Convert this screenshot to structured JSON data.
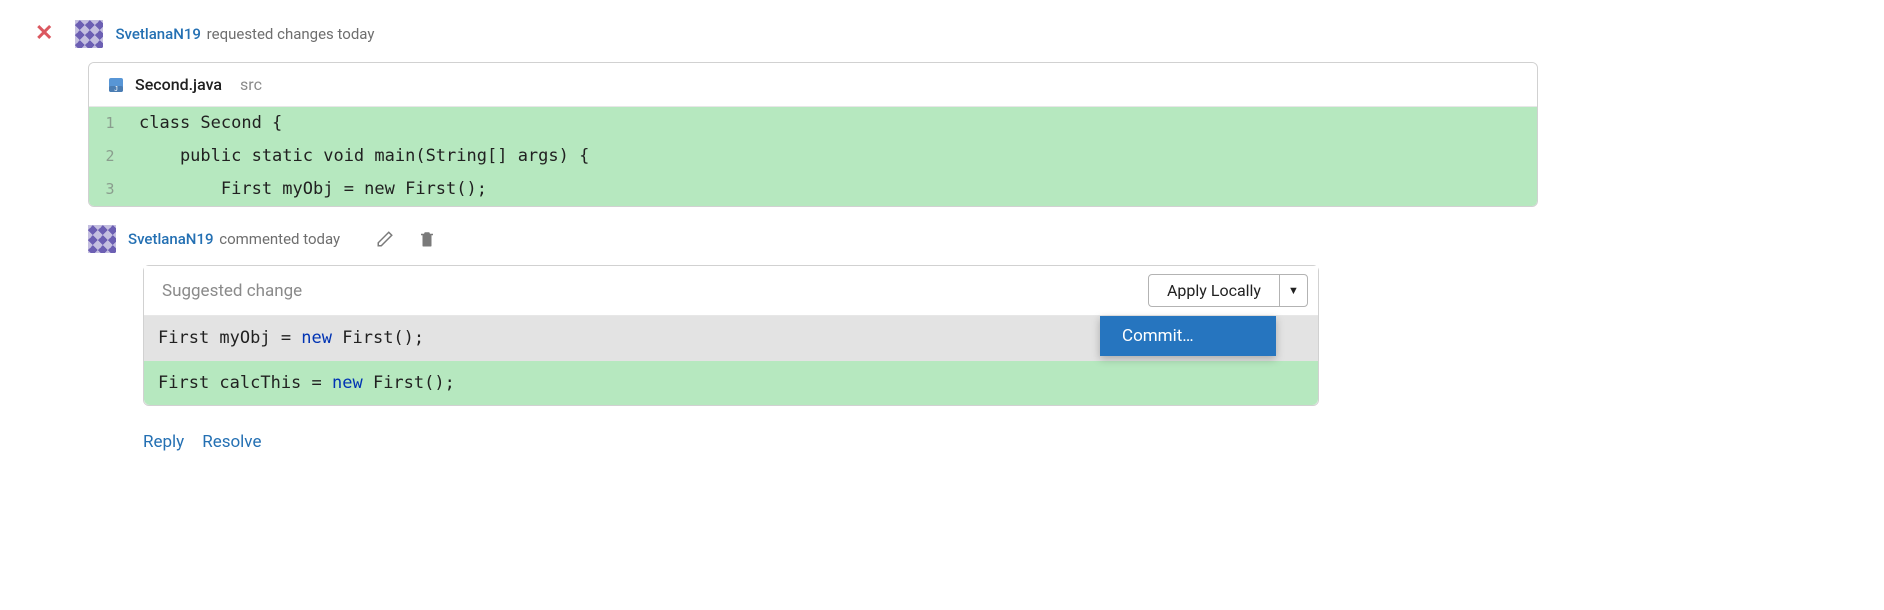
{
  "review": {
    "username": "SvetlanaN19",
    "action_text": "requested changes today"
  },
  "file": {
    "name": "Second.java",
    "dir": "src"
  },
  "code": {
    "lines": [
      {
        "num": "1",
        "text": "class Second {"
      },
      {
        "num": "2",
        "text": "    public static void main(String[] args) {"
      },
      {
        "num": "3",
        "text": "        First myObj = new First();"
      }
    ]
  },
  "comment": {
    "username": "SvetlanaN19",
    "action_text": "commented today"
  },
  "suggestion": {
    "label": "Suggested change",
    "apply_label": "Apply Locally",
    "old_prefix": "First myObj = ",
    "old_kw": "new",
    "old_suffix": " First();",
    "new_prefix": "First calcThis = ",
    "new_kw": "new",
    "new_suffix": " First();"
  },
  "dropdown": {
    "item": "Commit…"
  },
  "actions": {
    "reply": "Reply",
    "resolve": "Resolve"
  }
}
